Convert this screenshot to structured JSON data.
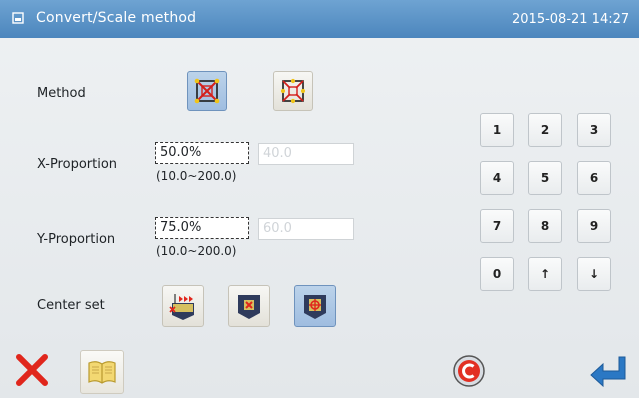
{
  "titlebar": {
    "title": "Convert/Scale method",
    "datetime": "2015-08-21 14:27"
  },
  "method": {
    "label": "Method",
    "options": [
      {
        "icon": "scale-square-icon",
        "selected": true
      },
      {
        "icon": "scale-cross-icon",
        "selected": false
      }
    ]
  },
  "x_proportion": {
    "label": "X-Proportion",
    "value": "50.0%",
    "result": "40.0",
    "range": "(10.0~200.0)"
  },
  "y_proportion": {
    "label": "Y-Proportion",
    "value": "75.0%",
    "result": "60.0",
    "range": "(10.0~200.0)"
  },
  "center_set": {
    "label": "Center set",
    "options": [
      {
        "icon": "origin-arrow-icon",
        "selected": false
      },
      {
        "icon": "center-x-icon",
        "selected": false
      },
      {
        "icon": "center-target-icon",
        "selected": true
      }
    ]
  },
  "keypad": {
    "keys": [
      "1",
      "2",
      "3",
      "4",
      "5",
      "6",
      "7",
      "8",
      "9",
      "0",
      "↑",
      "↓"
    ]
  },
  "bottom": {
    "buttons": [
      "cancel-x-icon",
      "book-icon",
      "copyright-c-icon",
      "enter-return-icon"
    ]
  },
  "colors": {
    "titlebar": "#5a91c6",
    "selected_button": "#a9c6e6",
    "cancel_red": "#e0261c",
    "enter_blue": "#2b78c4"
  }
}
